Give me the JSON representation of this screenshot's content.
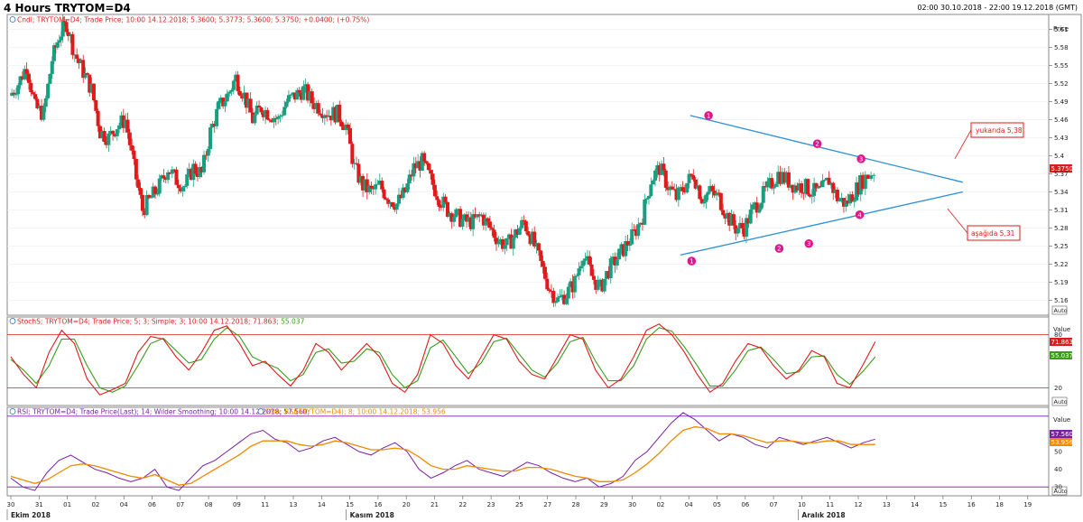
{
  "header": {
    "title": "4 Hours TRYTOM=D4",
    "range": "02:00 30.10.2018 - 22:00 19.12.2018 (GMT)"
  },
  "colors": {
    "up": "#1a9e80",
    "down": "#e01a1a",
    "trend": "#2e8fd6",
    "marker": "#e0168c",
    "stoch_k": "#e01a1a",
    "stoch_d": "#3a9c1a",
    "rsi": "#7b1fa2",
    "ema": "#f08a00"
  },
  "panels": {
    "price": {
      "legend": "Cndl; TRYTOM=D4; Trade Price; 10:00 14.12.2018; 5.3600; 5.3773; 5.3600; 5.3750; +0.0400; (+0.75%)",
      "axis_title": "Price",
      "last_value": "5.3750",
      "auto_label": "Auto"
    },
    "stoch": {
      "legend": "StochS; TRYTOM=D4; Trade Price;  5;  3; Simple;  3;  10:00 14.12.2018; 71.863;",
      "legend_value2": " 55.037",
      "axis_title": "Value",
      "last_k": "71.863",
      "last_d": "55.037",
      "auto_label": "Auto"
    },
    "rsi": {
      "legend": "RSI; TRYTOM=D4; Trade Price(Last);  14; Wilder Smoothing;  10:00 14.12.2018; 57.560;",
      "legend2": "EMA; RSI(TRYTOM=D4);  8;  10:00 14.12.2018; 53.956",
      "axis_title": "Value",
      "last_rsi": "57.560",
      "last_ema": "53.956",
      "auto_label": "Auto"
    }
  },
  "annotations": {
    "upper_box": "yukarıda 5,38",
    "lower_box": "aşağıda 5,31",
    "markers": [
      {
        "label": "1",
        "x": 24.7,
        "y": 5.467
      },
      {
        "label": "1",
        "x": 24.1,
        "y": 5.225
      },
      {
        "label": "2",
        "x": 28.55,
        "y": 5.42
      },
      {
        "label": "2",
        "x": 27.2,
        "y": 5.246
      },
      {
        "label": "3",
        "x": 30.1,
        "y": 5.395
      },
      {
        "label": "3",
        "x": 28.25,
        "y": 5.254
      },
      {
        "label": "4",
        "x": 30.05,
        "y": 5.302
      }
    ],
    "trendlines": [
      {
        "x1": 24.05,
        "y1": 5.467,
        "x2": 33.7,
        "y2": 5.356
      },
      {
        "x1": 23.7,
        "y1": 5.235,
        "x2": 33.7,
        "y2": 5.34
      }
    ]
  },
  "chart_data": [
    {
      "type": "candlestick",
      "title": "4 Hours TRYTOM=D4",
      "ylabel": "Price",
      "ylim": [
        5.135,
        5.635
      ],
      "yticks": [
        5.16,
        5.19,
        5.22,
        5.25,
        5.28,
        5.31,
        5.34,
        5.37,
        5.4,
        5.43,
        5.46,
        5.49,
        5.52,
        5.55,
        5.58,
        5.61
      ],
      "ytick_labels": [
        "5.16",
        "5.19",
        "5.22",
        "5.25",
        "5.28",
        "5.31",
        "5.34",
        "5.37",
        "5.4",
        "5.43",
        "5.46",
        "5.49",
        "5.52",
        "5.55",
        "5.58",
        "5.61"
      ],
      "xlim": [
        0,
        33.9
      ],
      "xticks": [
        {
          "x": 0,
          "label": "30"
        },
        {
          "x": 1,
          "label": "31"
        },
        {
          "x": 2,
          "label": "01"
        },
        {
          "x": 3,
          "label": "02"
        },
        {
          "x": 4,
          "label": "04"
        },
        {
          "x": 5,
          "label": "06"
        },
        {
          "x": 6,
          "label": "07"
        },
        {
          "x": 7,
          "label": "08"
        },
        {
          "x": 8,
          "label": "09"
        },
        {
          "x": 9,
          "label": "11"
        },
        {
          "x": 10,
          "label": "13"
        },
        {
          "x": 11,
          "label": "14"
        },
        {
          "x": 12,
          "label": "15"
        },
        {
          "x": 13,
          "label": "16"
        },
        {
          "x": 14,
          "label": "20"
        },
        {
          "x": 15,
          "label": "21"
        },
        {
          "x": 16,
          "label": "22"
        },
        {
          "x": 17,
          "label": "23"
        },
        {
          "x": 18,
          "label": "25"
        },
        {
          "x": 19,
          "label": "27"
        },
        {
          "x": 20,
          "label": "28"
        },
        {
          "x": 21,
          "label": "29"
        },
        {
          "x": 22,
          "label": "30"
        },
        {
          "x": 23,
          "label": "02"
        },
        {
          "x": 24,
          "label": "04"
        },
        {
          "x": 25,
          "label": "05"
        },
        {
          "x": 26,
          "label": "06"
        },
        {
          "x": 27,
          "label": "07"
        },
        {
          "x": 28,
          "label": "10"
        },
        {
          "x": 29,
          "label": "11"
        },
        {
          "x": 30,
          "label": "12"
        },
        {
          "x": 31,
          "label": "13"
        },
        {
          "x": 32,
          "label": "14"
        },
        {
          "x": 33,
          "label": "15"
        },
        {
          "x": 34,
          "label": "16"
        },
        {
          "x": 35,
          "label": "18"
        },
        {
          "x": 36,
          "label": "19"
        }
      ],
      "months": [
        {
          "x": 0,
          "label": "Ekim 2018"
        },
        {
          "x": 12,
          "label": "Kasım 2018"
        },
        {
          "x": 28,
          "label": "Aralık 2018"
        }
      ],
      "close_path": [
        [
          0,
          5.5
        ],
        [
          0.3,
          5.52
        ],
        [
          0.6,
          5.55
        ],
        [
          0.9,
          5.48
        ],
        [
          1.2,
          5.47
        ],
        [
          1.5,
          5.56
        ],
        [
          1.75,
          5.6
        ],
        [
          2.0,
          5.62
        ],
        [
          2.3,
          5.57
        ],
        [
          2.6,
          5.54
        ],
        [
          2.9,
          5.51
        ],
        [
          3.2,
          5.44
        ],
        [
          3.5,
          5.43
        ],
        [
          3.8,
          5.45
        ],
        [
          4.1,
          5.46
        ],
        [
          4.4,
          5.38
        ],
        [
          4.7,
          5.31
        ],
        [
          5.0,
          5.33
        ],
        [
          5.3,
          5.35
        ],
        [
          5.6,
          5.38
        ],
        [
          5.9,
          5.36
        ],
        [
          6.2,
          5.35
        ],
        [
          6.5,
          5.38
        ],
        [
          6.8,
          5.37
        ],
        [
          7.1,
          5.44
        ],
        [
          7.4,
          5.48
        ],
        [
          7.7,
          5.5
        ],
        [
          8.0,
          5.53
        ],
        [
          8.3,
          5.5
        ],
        [
          8.6,
          5.46
        ],
        [
          8.9,
          5.48
        ],
        [
          9.2,
          5.47
        ],
        [
          9.5,
          5.46
        ],
        [
          9.8,
          5.49
        ],
        [
          10.1,
          5.5
        ],
        [
          10.4,
          5.51
        ],
        [
          10.7,
          5.49
        ],
        [
          11.0,
          5.48
        ],
        [
          11.3,
          5.47
        ],
        [
          11.6,
          5.47
        ],
        [
          11.9,
          5.45
        ],
        [
          12.2,
          5.38
        ],
        [
          12.5,
          5.35
        ],
        [
          12.8,
          5.34
        ],
        [
          13.1,
          5.35
        ],
        [
          13.4,
          5.33
        ],
        [
          13.7,
          5.32
        ],
        [
          14.0,
          5.34
        ],
        [
          14.3,
          5.38
        ],
        [
          14.6,
          5.39
        ],
        [
          14.9,
          5.36
        ],
        [
          15.2,
          5.33
        ],
        [
          15.5,
          5.31
        ],
        [
          15.8,
          5.3
        ],
        [
          16.1,
          5.29
        ],
        [
          16.4,
          5.29
        ],
        [
          16.7,
          5.3
        ],
        [
          17.0,
          5.28
        ],
        [
          17.3,
          5.26
        ],
        [
          17.6,
          5.25
        ],
        [
          17.9,
          5.27
        ],
        [
          18.2,
          5.29
        ],
        [
          18.5,
          5.26
        ],
        [
          18.8,
          5.22
        ],
        [
          19.1,
          5.18
        ],
        [
          19.4,
          5.16
        ],
        [
          19.7,
          5.17
        ],
        [
          20.0,
          5.19
        ],
        [
          20.3,
          5.24
        ],
        [
          20.6,
          5.2
        ],
        [
          20.9,
          5.18
        ],
        [
          21.2,
          5.21
        ],
        [
          21.5,
          5.23
        ],
        [
          21.8,
          5.25
        ],
        [
          22.1,
          5.27
        ],
        [
          22.4,
          5.3
        ],
        [
          22.7,
          5.36
        ],
        [
          23.0,
          5.38
        ],
        [
          23.3,
          5.35
        ],
        [
          23.6,
          5.33
        ],
        [
          23.9,
          5.35
        ],
        [
          24.2,
          5.37
        ],
        [
          24.5,
          5.33
        ],
        [
          24.8,
          5.34
        ],
        [
          25.1,
          5.33
        ],
        [
          25.4,
          5.3
        ],
        [
          25.7,
          5.28
        ],
        [
          26.0,
          5.28
        ],
        [
          26.3,
          5.31
        ],
        [
          26.6,
          5.33
        ],
        [
          26.9,
          5.35
        ],
        [
          27.2,
          5.37
        ],
        [
          27.5,
          5.36
        ],
        [
          27.8,
          5.35
        ],
        [
          28.1,
          5.35
        ],
        [
          28.4,
          5.34
        ],
        [
          28.7,
          5.34
        ],
        [
          29.0,
          5.36
        ],
        [
          29.3,
          5.33
        ],
        [
          29.6,
          5.32
        ],
        [
          29.9,
          5.34
        ],
        [
          30.2,
          5.36
        ],
        [
          30.6,
          5.375
        ]
      ]
    },
    {
      "type": "line",
      "title": "StochS; TRYTOM=D4; Trade Price; 5; 3; Simple; 3",
      "ylabel": "Value",
      "ylim": [
        0,
        100
      ],
      "yticks": [
        20,
        80
      ],
      "ytick_labels": [
        "20",
        "80"
      ],
      "hlines": [
        20,
        80
      ],
      "series": [
        {
          "name": "%K",
          "values": [
            55,
            35,
            20,
            60,
            85,
            70,
            30,
            12,
            18,
            25,
            60,
            78,
            75,
            55,
            40,
            60,
            85,
            90,
            70,
            45,
            50,
            35,
            22,
            40,
            70,
            60,
            40,
            55,
            70,
            55,
            25,
            15,
            35,
            80,
            70,
            45,
            30,
            55,
            80,
            75,
            50,
            35,
            30,
            55,
            80,
            75,
            40,
            20,
            30,
            55,
            85,
            92,
            80,
            60,
            35,
            15,
            25,
            50,
            70,
            65,
            45,
            30,
            40,
            62,
            55,
            25,
            20,
            45,
            72
          ]
        },
        {
          "name": "%D",
          "values": [
            52,
            40,
            25,
            45,
            75,
            75,
            45,
            20,
            15,
            22,
            45,
            70,
            76,
            62,
            48,
            52,
            75,
            88,
            78,
            55,
            48,
            42,
            28,
            35,
            60,
            64,
            48,
            50,
            64,
            60,
            35,
            20,
            28,
            65,
            74,
            55,
            36,
            48,
            72,
            76,
            58,
            40,
            32,
            48,
            72,
            77,
            50,
            28,
            28,
            45,
            75,
            88,
            84,
            66,
            45,
            22,
            22,
            40,
            62,
            66,
            52,
            36,
            38,
            55,
            56,
            35,
            24,
            38,
            55
          ]
        }
      ]
    },
    {
      "type": "line",
      "title": "RSI; TRYTOM=D4; Trade Price(Last); 14; Wilder Smoothing",
      "ylabel": "Value",
      "ylim": [
        25,
        75
      ],
      "yticks": [
        30,
        40,
        50
      ],
      "ytick_labels": [
        "30",
        "40",
        "50"
      ],
      "hlines": [
        30,
        70
      ],
      "series": [
        {
          "name": "RSI",
          "values": [
            35,
            30,
            28,
            38,
            45,
            48,
            44,
            40,
            38,
            35,
            33,
            35,
            40,
            30,
            28,
            35,
            42,
            45,
            50,
            55,
            60,
            62,
            57,
            55,
            50,
            52,
            56,
            58,
            54,
            50,
            48,
            52,
            55,
            50,
            40,
            35,
            38,
            42,
            45,
            40,
            38,
            36,
            40,
            44,
            42,
            38,
            35,
            33,
            35,
            30,
            32,
            36,
            45,
            50,
            58,
            66,
            72,
            68,
            62,
            56,
            60,
            58,
            54,
            52,
            58,
            56,
            54,
            56,
            58,
            55,
            52,
            55,
            57
          ]
        },
        {
          "name": "EMA",
          "values": [
            36,
            34,
            32,
            34,
            38,
            42,
            43,
            42,
            40,
            38,
            36,
            35,
            37,
            34,
            31,
            32,
            36,
            40,
            44,
            48,
            53,
            56,
            56,
            56,
            54,
            53,
            54,
            56,
            55,
            53,
            51,
            51,
            52,
            51,
            47,
            42,
            40,
            40,
            42,
            41,
            40,
            39,
            39,
            41,
            41,
            40,
            38,
            36,
            35,
            33,
            33,
            34,
            38,
            43,
            49,
            56,
            62,
            64,
            63,
            60,
            60,
            59,
            57,
            55,
            56,
            56,
            55,
            55,
            56,
            56,
            54,
            54,
            54
          ]
        }
      ]
    }
  ]
}
